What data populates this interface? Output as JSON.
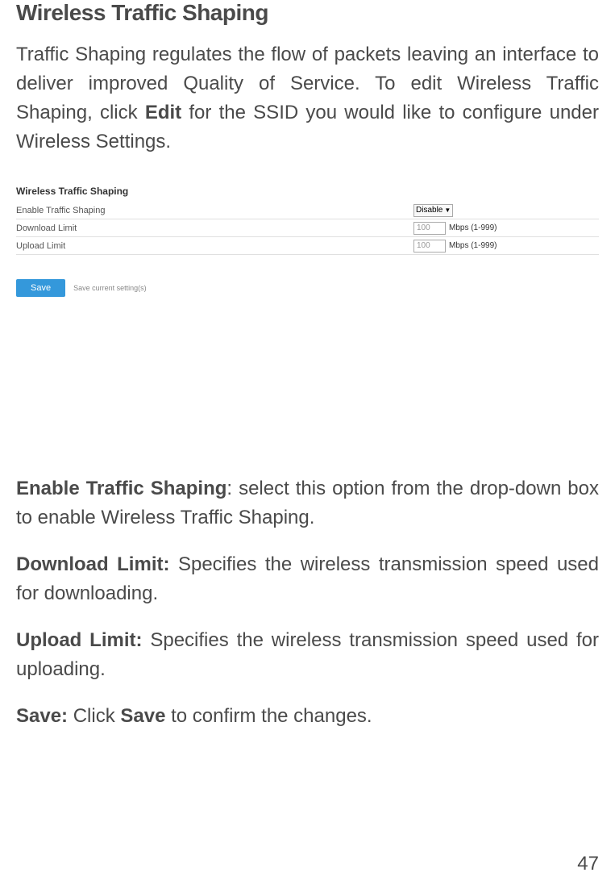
{
  "heading": "Wireless Traffic Shaping",
  "intro": {
    "part1": "Traffic Shaping regulates the flow of packets leaving an interface to deliver improved Quality of Service. To edit Wireless Traffic Shaping, click ",
    "bold1": "Edit",
    "part2": " for the SSID you would like to configure under Wireless Settings."
  },
  "panel": {
    "title": "Wireless Traffic Shaping",
    "rows": {
      "enable": {
        "label": "Enable Traffic Shaping",
        "value": "Disable"
      },
      "download": {
        "label": "Download Limit",
        "value": "100",
        "unit": "Mbps (1-999)"
      },
      "upload": {
        "label": "Upload Limit",
        "value": "100",
        "unit": "Mbps (1-999)"
      }
    },
    "save_label": "Save",
    "save_hint": "Save current setting(s)"
  },
  "definitions": {
    "enable": {
      "term": "Enable Traffic Shaping",
      "desc": ": select this option from the drop-down box to enable Wireless Traffic Shaping."
    },
    "download": {
      "term": "Download Limit:",
      "desc": " Specifies the wireless transmission speed used for downloading."
    },
    "upload": {
      "term": "Upload Limit:",
      "desc": " Specifies the wireless transmission speed used for uploading."
    },
    "save": {
      "term": "Save:",
      "mid": " Click ",
      "bold2": "Save",
      "desc": " to confirm the changes."
    }
  },
  "page_number": "47"
}
